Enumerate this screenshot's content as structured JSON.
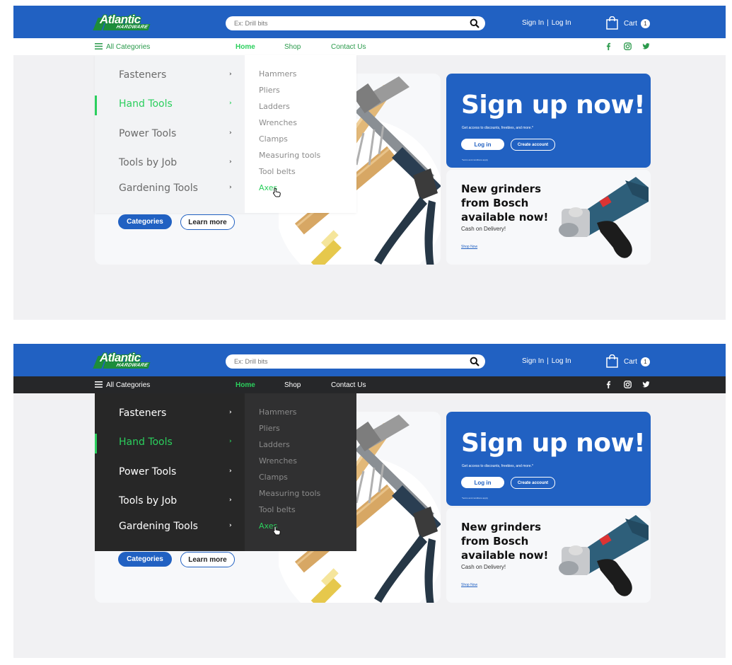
{
  "brand": {
    "logo_line1": "Atlantic",
    "logo_line2": "HARDWARE",
    "primary": "#2161c2",
    "accent_green": "#2bcf5d",
    "dark_nav": "#262729"
  },
  "search": {
    "placeholder": "Ex: Drill bits",
    "icon": "search-icon"
  },
  "header": {
    "sign_in": "Sign In",
    "separator": "|",
    "log_in": "Log In",
    "cart_label": "Cart",
    "cart_count": "1"
  },
  "nav": {
    "all_categories": "All Categories",
    "links": [
      "Home",
      "Shop",
      "Contact Us"
    ],
    "social_icons": [
      "facebook-icon",
      "instagram-icon",
      "twitter-icon"
    ],
    "social_glyphs": [
      "f",
      "◎",
      "🐦"
    ]
  },
  "menu": {
    "categories": [
      {
        "label": "Fasteners",
        "active": false
      },
      {
        "label": "Hand Tools",
        "active": true
      },
      {
        "label": "Power Tools",
        "active": false
      },
      {
        "label": "Tools by  Job",
        "active": false
      },
      {
        "label": "Gardening Tools",
        "active": false
      }
    ],
    "chevron": "›",
    "subitems": [
      "Hammers",
      "Pliers",
      "Ladders",
      "Wrenches",
      "Clamps",
      "Measuring tools",
      "Tool belts",
      "Axes"
    ],
    "hovered_subitem": "Axes"
  },
  "hero": {
    "categories_button": "Categories",
    "learn_more_button": "Learn more"
  },
  "signup": {
    "title": "Sign up now!",
    "subtitle": "Get access to discounts, freebies, and more.*",
    "login_button": "Log in",
    "create_button": "Create account",
    "terms": "*terms and conditions apply"
  },
  "promo": {
    "title": "New grinders from Bosch available now!",
    "subtitle": "Cash on Delivery!",
    "link": "Shop Now"
  },
  "variants": [
    "light",
    "dark"
  ]
}
